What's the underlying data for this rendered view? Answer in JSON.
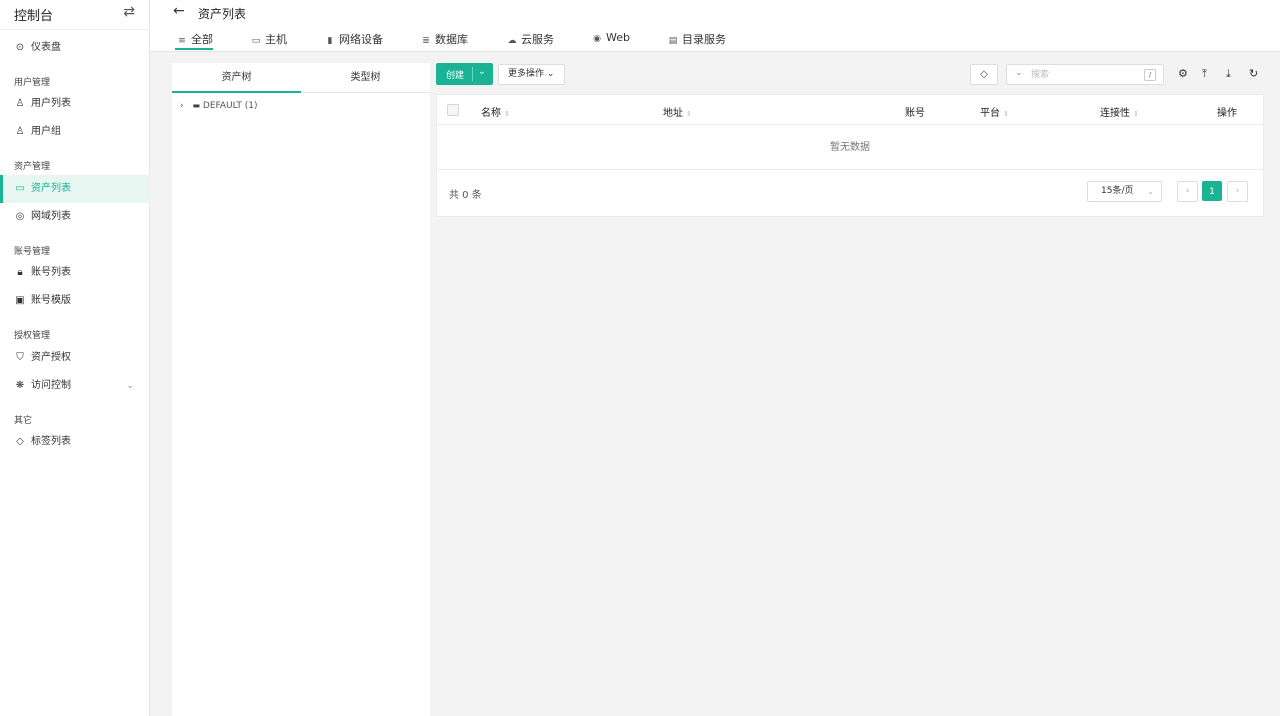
{
  "sidebar": {
    "title": "控制台",
    "switch_icon": "⇄",
    "items": [
      {
        "label": "仪表盘",
        "icon": "⊙"
      },
      {
        "label": "用户列表",
        "icon": "♙"
      },
      {
        "label": "用户组",
        "icon": "♙"
      },
      {
        "label": "资产列表",
        "icon": "▭"
      },
      {
        "label": "网域列表",
        "icon": "◎"
      },
      {
        "label": "账号列表",
        "icon": "🔒︎"
      },
      {
        "label": "账号模版",
        "icon": "▣"
      },
      {
        "label": "资产授权",
        "icon": "⛉"
      },
      {
        "label": "访问控制",
        "icon": "❋",
        "chevron": "⌄"
      },
      {
        "label": "标签列表",
        "icon": "◇"
      }
    ],
    "groups": [
      "用户管理",
      "资产管理",
      "账号管理",
      "授权管理",
      "其它"
    ]
  },
  "header": {
    "back_icon": "←",
    "title": "资产列表",
    "tabs": [
      {
        "label": "全部",
        "icon": "≡"
      },
      {
        "label": "主机",
        "icon": "▭"
      },
      {
        "label": "网络设备",
        "icon": "▮"
      },
      {
        "label": "数据库",
        "icon": "≣"
      },
      {
        "label": "云服务",
        "icon": "☁"
      },
      {
        "label": "Web",
        "icon": "◉"
      },
      {
        "label": "目录服务",
        "icon": "▤"
      }
    ]
  },
  "tree": {
    "tabs": [
      "资产树",
      "类型树"
    ],
    "node": {
      "expander": "›",
      "icon": "▬",
      "label": "DEFAULT (1)"
    }
  },
  "toolbar": {
    "create_label": "创建",
    "dropdown_icon": "⌄",
    "more_label": "更多操作 ⌄",
    "tag_icon": "◇",
    "search_chevron": "⌄",
    "search_placeholder": "搜索",
    "search_shortcut": "/",
    "settings_icon": "⚙",
    "export_icon": "⤒",
    "import_icon": "⤓",
    "refresh_icon": "↻"
  },
  "table": {
    "columns": [
      "名称",
      "地址",
      "账号",
      "平台",
      "连接性",
      "操作"
    ],
    "sort_icon": "⇕",
    "empty_text": "暂无数据",
    "rows": []
  },
  "pagination": {
    "total": "共 0 条",
    "page_size": "15条/页",
    "prev": "‹",
    "current": "1",
    "next": "›"
  },
  "colors": {
    "accent": "#1ab394"
  }
}
